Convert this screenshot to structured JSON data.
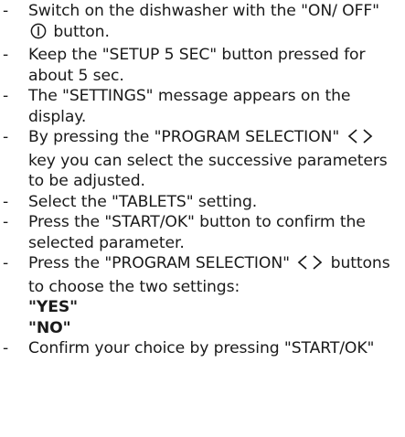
{
  "bullet": "-",
  "steps": [
    {
      "text_a": "Switch on the dishwasher with the \"ON/ OFF\" ",
      "icon": "power-icon",
      "text_b": " button."
    },
    {
      "text": "Keep the \"SETUP 5 SEC\" button pressed for about 5 sec."
    },
    {
      "text": "The \"SETTINGS\" message appears on the display."
    },
    {
      "text_a": "By pressing the \"PROGRAM SELECTION\" ",
      "icon": "left-right-arrows-icon",
      "text_b": " key you can select the successive parameters to be adjusted."
    },
    {
      "text": "Select the \"TABLETS\" setting."
    },
    {
      "text": "Press the \"START/OK\" button to confirm the selected parameter."
    },
    {
      "text_a": "Press the \"PROGRAM SELECTION\" ",
      "icon": "left-right-arrows-icon",
      "text_b": " buttons to choose the two settings:",
      "options": [
        "\"YES\"",
        "\"NO\""
      ]
    },
    {
      "text": "Confirm your choice by pressing \"START/OK\""
    }
  ]
}
